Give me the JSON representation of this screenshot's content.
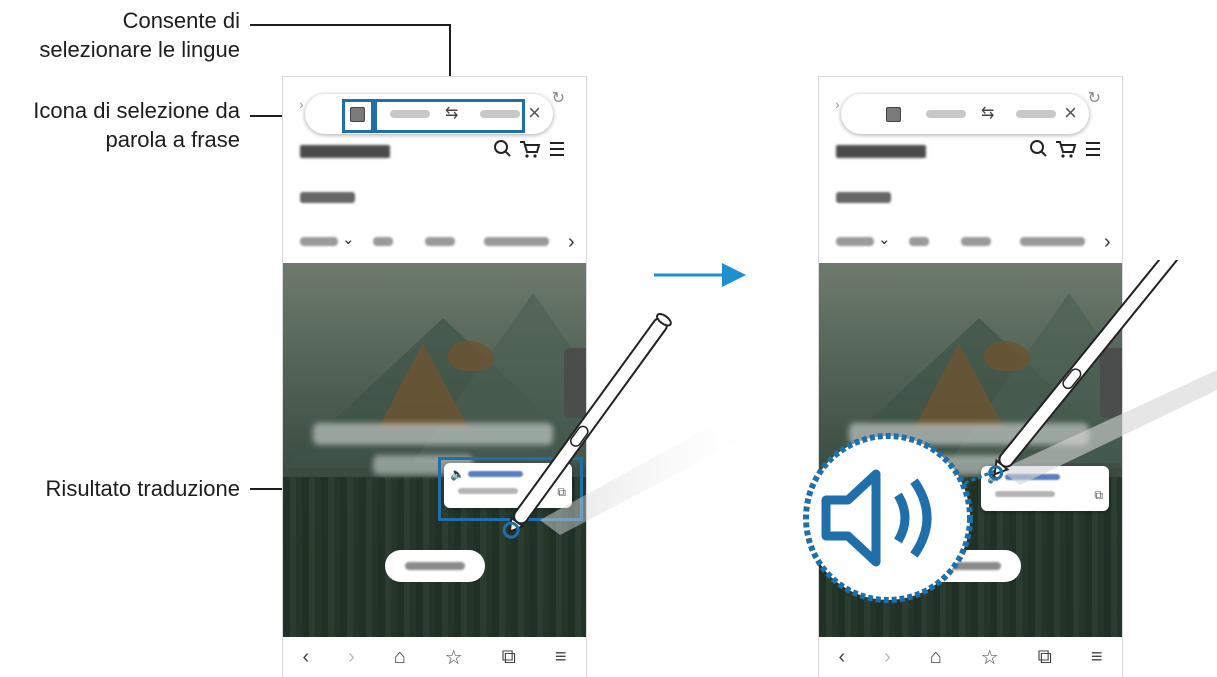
{
  "callouts": {
    "language_select": "Consente di\nselezionare le lingue",
    "word_sentence_icon": "Icona di selezione da\nparola a frase",
    "translation_result": "Risultato traduzione"
  },
  "toolbar": {
    "back_glyph": "←",
    "forward_glyph": "›",
    "swap_glyph": "⇆",
    "close_glyph": "×",
    "refresh_glyph": "↻"
  },
  "header": {
    "icons": "⌕ ☰"
  },
  "bottom_nav": {
    "back": "‹",
    "forward": "›",
    "home": "⌂",
    "bookmark": "☆",
    "tabs": "⧉",
    "menu": "≡"
  },
  "colors": {
    "accent": "#1f6fab",
    "arrow": "#1e8fd0"
  },
  "icons": [
    "search-icon",
    "cart-icon",
    "menu-icon",
    "speaker-icon",
    "copy-icon",
    "close-icon",
    "swap-icon",
    "refresh-icon",
    "home-icon",
    "bookmark-icon",
    "tabs-icon",
    "chevron-right-icon",
    "chevron-down-icon"
  ]
}
